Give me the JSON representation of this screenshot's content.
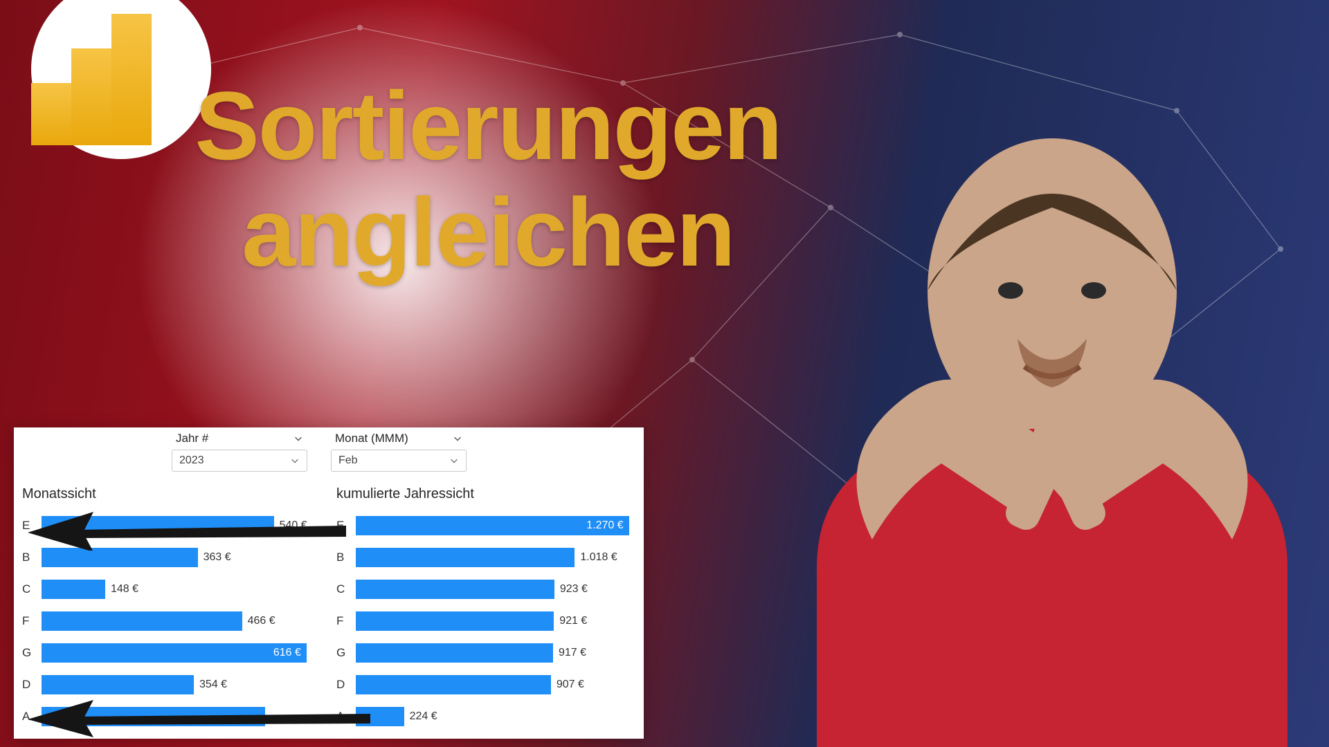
{
  "headline_line1": "Sortierungen",
  "headline_line2": "angleichen",
  "slicers": {
    "year": {
      "label": "Jahr #",
      "value": "2023"
    },
    "month": {
      "label": "Monat (MMM)",
      "value": "Feb"
    }
  },
  "chart_data": [
    {
      "type": "bar",
      "orientation": "horizontal",
      "title": "Monatssicht",
      "xlabel": "",
      "ylabel": "",
      "xlim": [
        0,
        650
      ],
      "categories": [
        "E",
        "B",
        "C",
        "F",
        "G",
        "D",
        "A"
      ],
      "values": [
        540,
        363,
        148,
        466,
        616,
        354,
        520
      ],
      "value_labels": [
        "540 €",
        "363 €",
        "148 €",
        "466 €",
        "616 €",
        "354 €",
        ""
      ]
    },
    {
      "type": "bar",
      "orientation": "horizontal",
      "title": "kumulierte Jahressicht",
      "xlabel": "",
      "ylabel": "",
      "xlim": [
        0,
        1300
      ],
      "categories": [
        "E",
        "B",
        "C",
        "F",
        "G",
        "D",
        "A"
      ],
      "values": [
        1270,
        1018,
        923,
        921,
        917,
        907,
        224
      ],
      "value_labels": [
        "1.270 €",
        "1.018 €",
        "923 €",
        "921 €",
        "917 €",
        "907 €",
        "224 €"
      ]
    }
  ],
  "icons": {
    "chevron_down": "chevron-down-icon"
  },
  "colors": {
    "accent": "#e1a92b",
    "bar": "#1f8ef7"
  }
}
